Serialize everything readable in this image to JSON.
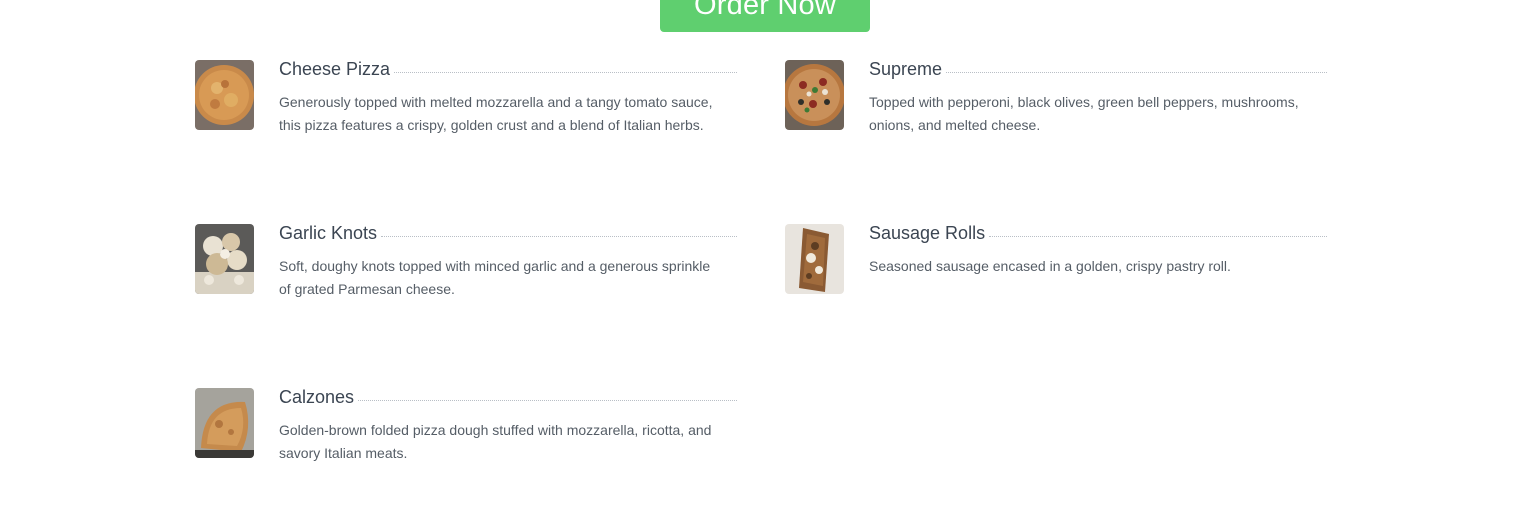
{
  "order_button": {
    "label": "Order Now"
  },
  "colors": {
    "accent": "#5fcf6f",
    "dots": "#b9bfc6",
    "title": "#3b4552",
    "text": "#555d66"
  },
  "menu": {
    "items": [
      {
        "name": "Cheese Pizza",
        "description": "Generously topped with melted mozzarella and a tangy tomato sauce, this pizza features a crispy, golden crust and a blend of Italian herbs.",
        "icon": "cheese-pizza-photo"
      },
      {
        "name": "Supreme",
        "description": "Topped with pepperoni, black olives, green bell peppers, mushrooms, onions, and melted cheese.",
        "icon": "supreme-pizza-photo"
      },
      {
        "name": "Garlic Knots",
        "description": "Soft, doughy knots topped with minced garlic and a generous sprinkle of grated Parmesan cheese.",
        "icon": "garlic-knots-photo"
      },
      {
        "name": "Sausage Rolls",
        "description": "Seasoned sausage encased in a golden, crispy pastry roll.",
        "icon": "sausage-rolls-photo"
      },
      {
        "name": "Calzones",
        "description": "Golden-brown folded pizza dough stuffed with mozzarella, ricotta, and savory Italian meats.",
        "icon": "calzones-photo"
      }
    ]
  }
}
